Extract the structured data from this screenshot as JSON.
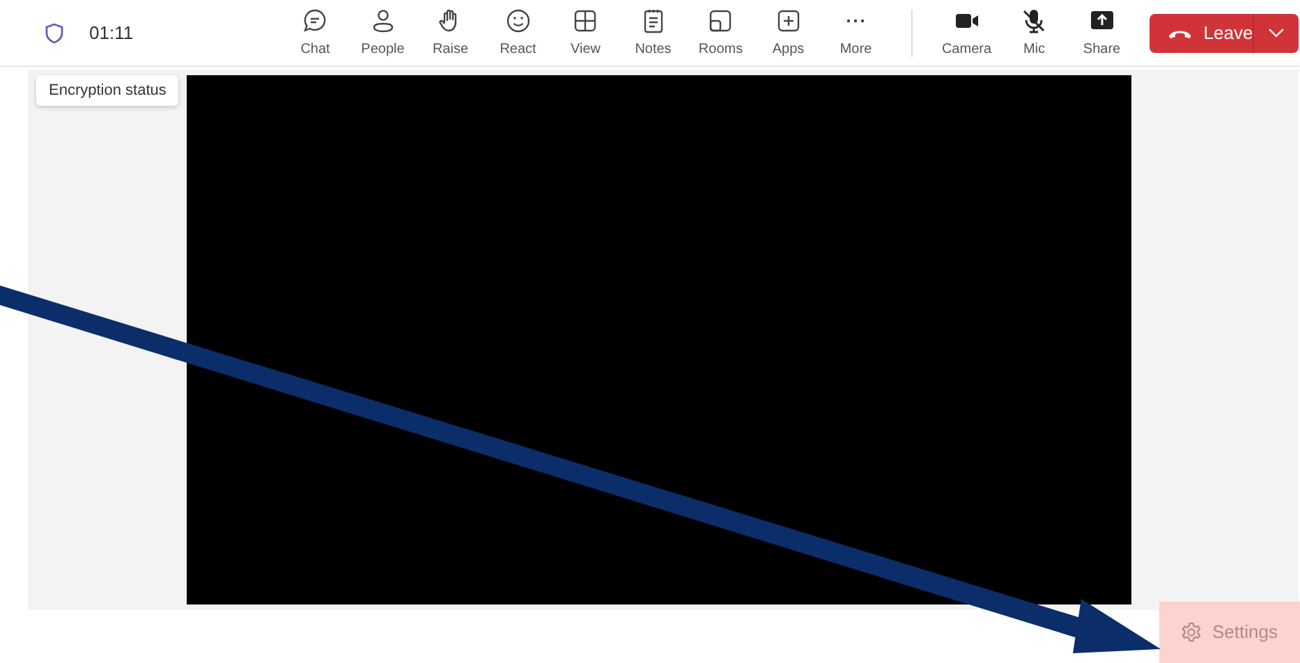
{
  "meeting": {
    "timer": "01:11",
    "tooltip": "Encryption status"
  },
  "toolbar": {
    "actions": [
      {
        "kind": "chat",
        "label": "Chat"
      },
      {
        "kind": "people",
        "label": "People"
      },
      {
        "kind": "raise",
        "label": "Raise"
      },
      {
        "kind": "react",
        "label": "React"
      },
      {
        "kind": "view",
        "label": "View"
      },
      {
        "kind": "notes",
        "label": "Notes"
      },
      {
        "kind": "rooms",
        "label": "Rooms"
      },
      {
        "kind": "apps",
        "label": "Apps"
      },
      {
        "kind": "more",
        "label": "More"
      }
    ],
    "camera": {
      "label": "Camera"
    },
    "mic": {
      "label": "Mic",
      "muted": true
    },
    "share": {
      "label": "Share"
    },
    "leave": {
      "label": "Leave"
    }
  },
  "settings": {
    "label": "Settings"
  }
}
